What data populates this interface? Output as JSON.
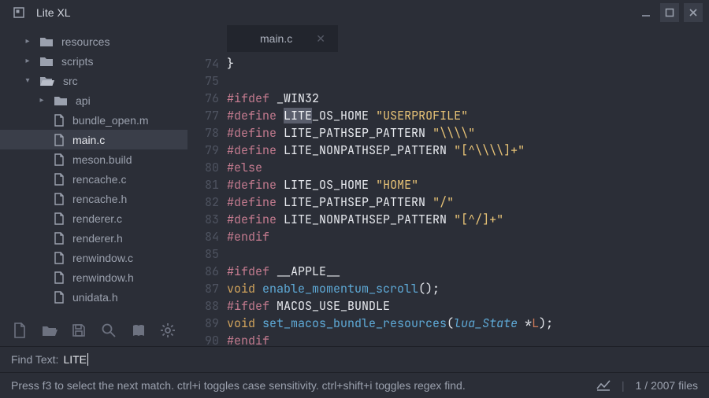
{
  "window": {
    "title": "Lite XL"
  },
  "sidebar": {
    "items": [
      {
        "type": "folder",
        "label": "resources",
        "depth": 1,
        "expanded": false
      },
      {
        "type": "folder",
        "label": "scripts",
        "depth": 1,
        "expanded": false
      },
      {
        "type": "folder",
        "label": "src",
        "depth": 1,
        "expanded": true
      },
      {
        "type": "folder",
        "label": "api",
        "depth": 2,
        "expanded": false
      },
      {
        "type": "file",
        "label": "bundle_open.m",
        "depth": 2
      },
      {
        "type": "file",
        "label": "main.c",
        "depth": 2,
        "selected": true
      },
      {
        "type": "file",
        "label": "meson.build",
        "depth": 2
      },
      {
        "type": "file",
        "label": "rencache.c",
        "depth": 2
      },
      {
        "type": "file",
        "label": "rencache.h",
        "depth": 2
      },
      {
        "type": "file",
        "label": "renderer.c",
        "depth": 2
      },
      {
        "type": "file",
        "label": "renderer.h",
        "depth": 2
      },
      {
        "type": "file",
        "label": "renwindow.c",
        "depth": 2
      },
      {
        "type": "file",
        "label": "renwindow.h",
        "depth": 2
      },
      {
        "type": "file",
        "label": "unidata.h",
        "depth": 2
      }
    ]
  },
  "tab": {
    "label": "main.c"
  },
  "gutter": {
    "start": 74,
    "end": 90
  },
  "code": [
    [
      {
        "t": "}",
        "c": "brace"
      }
    ],
    [],
    [
      {
        "t": "#ifdef",
        "c": "prep"
      },
      {
        "t": " "
      },
      {
        "t": "_WIN32",
        "c": "macro"
      }
    ],
    [
      {
        "t": "#define",
        "c": "prep"
      },
      {
        "t": " "
      },
      {
        "t": "LITE",
        "c": "macro",
        "hl": true
      },
      {
        "t": "_OS_HOME",
        "c": "macro"
      },
      {
        "t": " "
      },
      {
        "t": "\"USERPROFILE\"",
        "c": "string"
      }
    ],
    [
      {
        "t": "#define",
        "c": "prep"
      },
      {
        "t": " "
      },
      {
        "t": "LITE_PATHSEP_PATTERN",
        "c": "macro"
      },
      {
        "t": " "
      },
      {
        "t": "\"\\\\\\\\\"",
        "c": "string"
      }
    ],
    [
      {
        "t": "#define",
        "c": "prep"
      },
      {
        "t": " "
      },
      {
        "t": "LITE_NONPATHSEP_PATTERN",
        "c": "macro"
      },
      {
        "t": " "
      },
      {
        "t": "\"[^\\\\\\\\]+\"",
        "c": "string"
      }
    ],
    [
      {
        "t": "#else",
        "c": "prep"
      }
    ],
    [
      {
        "t": "#define",
        "c": "prep"
      },
      {
        "t": " "
      },
      {
        "t": "LITE_OS_HOME",
        "c": "macro"
      },
      {
        "t": " "
      },
      {
        "t": "\"HOME\"",
        "c": "string"
      }
    ],
    [
      {
        "t": "#define",
        "c": "prep"
      },
      {
        "t": " "
      },
      {
        "t": "LITE_PATHSEP_PATTERN",
        "c": "macro"
      },
      {
        "t": " "
      },
      {
        "t": "\"/\"",
        "c": "string"
      }
    ],
    [
      {
        "t": "#define",
        "c": "prep"
      },
      {
        "t": " "
      },
      {
        "t": "LITE_NONPATHSEP_PATTERN",
        "c": "macro"
      },
      {
        "t": " "
      },
      {
        "t": "\"[^/]+\"",
        "c": "string"
      }
    ],
    [
      {
        "t": "#endif",
        "c": "prep"
      }
    ],
    [],
    [
      {
        "t": "#ifdef",
        "c": "prep"
      },
      {
        "t": " "
      },
      {
        "t": "__APPLE__",
        "c": "macro"
      }
    ],
    [
      {
        "t": "void",
        "c": "type"
      },
      {
        "t": " "
      },
      {
        "t": "enable_momentum_scroll",
        "c": "func"
      },
      {
        "t": "();",
        "c": "brace"
      }
    ],
    [
      {
        "t": "#ifdef",
        "c": "prep"
      },
      {
        "t": " "
      },
      {
        "t": "MACOS_USE_BUNDLE",
        "c": "macro"
      }
    ],
    [
      {
        "t": "void",
        "c": "type"
      },
      {
        "t": " "
      },
      {
        "t": "set_macos_bundle_resources",
        "c": "func"
      },
      {
        "t": "(",
        "c": "brace"
      },
      {
        "t": "lua_State",
        "c": "param"
      },
      {
        "t": " *",
        "c": "brace"
      },
      {
        "t": "L",
        "c": "paramn"
      },
      {
        "t": ");",
        "c": "brace"
      }
    ],
    [
      {
        "t": "#endif",
        "c": "prep"
      }
    ]
  ],
  "find": {
    "label": "Find Text:",
    "value": "LITE"
  },
  "status": {
    "hint": "Press f3 to select the next match. ctrl+i toggles case sensitivity. ctrl+shift+i toggles regex find.",
    "separator": "|",
    "files": "1 / 2007 files"
  },
  "toolbar": {
    "newfile": "new-file",
    "openfolder": "open-folder",
    "save": "save",
    "search": "search",
    "book": "book",
    "settings": "settings"
  }
}
